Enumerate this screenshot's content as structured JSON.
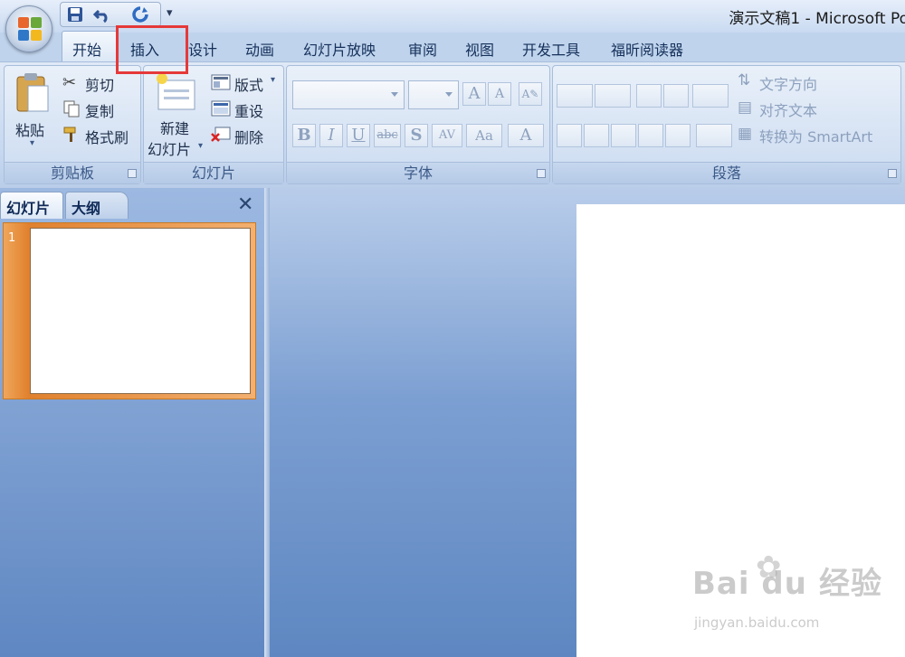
{
  "window": {
    "title": "演示文稿1 - Microsoft Po"
  },
  "quick_access": {
    "save_icon": "save-icon",
    "undo_icon": "undo-icon",
    "redo_icon": "redo-icon",
    "more_icon": "customize-qat-icon"
  },
  "tabs": [
    {
      "label": "开始",
      "active": true
    },
    {
      "label": "插入",
      "highlighted": true
    },
    {
      "label": "设计"
    },
    {
      "label": "动画"
    },
    {
      "label": "幻灯片放映"
    },
    {
      "label": "审阅"
    },
    {
      "label": "视图"
    },
    {
      "label": "开发工具"
    },
    {
      "label": "福昕阅读器"
    }
  ],
  "ribbon": {
    "clipboard": {
      "label": "剪贴板",
      "paste": "粘贴",
      "cut": "剪切",
      "copy": "复制",
      "format_painter": "格式刷"
    },
    "slides": {
      "label": "幻灯片",
      "new_slide_line1": "新建",
      "new_slide_line2": "幻灯片",
      "layout": "版式",
      "reset": "重设",
      "delete": "删除"
    },
    "font": {
      "label": "字体",
      "font_name": "",
      "font_size": "",
      "buttons": [
        "B",
        "I",
        "U",
        "abc",
        "S",
        "AV",
        "Aa",
        "A"
      ]
    },
    "paragraph": {
      "label": "段落",
      "text_direction": "文字方向",
      "align_text": "对齐文本",
      "convert_smartart": "转换为 SmartArt"
    }
  },
  "left_panel": {
    "tab_slides": "幻灯片",
    "tab_outline": "大纲",
    "close_icon": "close-icon",
    "slide_number": "1"
  },
  "watermark": {
    "brand": "Bai du",
    "brand_cn": "经验",
    "url": "jingyan.baidu.com"
  },
  "colors": {
    "highlight_box": "#e53939",
    "ribbon_bg": "#dfe9f6",
    "workspace": "#7c9fd2",
    "selected_thumb": "#e0812e"
  }
}
